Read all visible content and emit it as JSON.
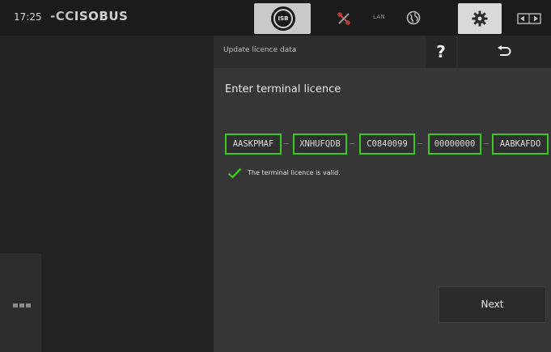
{
  "status_bar": {
    "time": "17:25",
    "brand_prefix": "-CC",
    "brand_suffix": "ISOBUS",
    "isb_label": "ISB",
    "lan_label": "LAN",
    "icons": [
      "isb-icon",
      "tools-icon",
      "lan-icon",
      "globe-icon",
      "gear-icon",
      "switch-screen-icon"
    ]
  },
  "panel": {
    "title": "Update licence data",
    "help_label": "?",
    "heading": "Enter terminal licence",
    "licence_fields": [
      "AASKPMAF",
      "XNHUFQDB",
      "C0840099",
      "00000000",
      "AABKAFDO"
    ],
    "status_message": "The terminal licence is valid.",
    "next_label": "Next"
  },
  "colors": {
    "accent_valid": "#3cc81e",
    "panel_bg": "#363636",
    "tool_red": "#d84040"
  }
}
